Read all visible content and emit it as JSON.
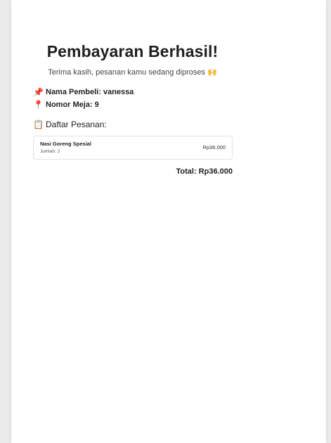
{
  "header": {
    "title": "Pembayaran Berhasil!",
    "subtitle": "Terima kasih, pesanan kamu sedang diproses 🙌"
  },
  "info": {
    "buyer_icon": "📌",
    "buyer_label": "Nama Pembeli:",
    "buyer_value": "vanessa",
    "table_icon": "📍",
    "table_label": "Nomor Meja:",
    "table_value": "9",
    "orders_icon": "📋",
    "orders_label": "Daftar Pesanan:"
  },
  "orders": [
    {
      "name": "Nasi Goreng Spesial",
      "qty": "Jumlah: 2",
      "price": "Rp36.000"
    }
  ],
  "total": "Total: Rp36.000",
  "colors": {
    "background": "#ececec",
    "card": "#ffffff",
    "text": "#1f1f1f"
  }
}
